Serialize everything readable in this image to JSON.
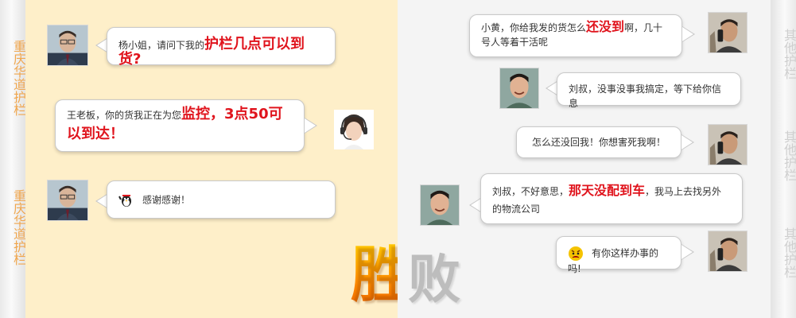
{
  "left_sidebar": {
    "label_1": "重庆华道护栏",
    "label_2": "重庆华道护栏",
    "color": "#f0a64d"
  },
  "right_sidebar": {
    "label_1": "其他护栏",
    "label_2": "其他护栏",
    "label_3": "其他护栏",
    "color": "#cfcfcf"
  },
  "left_panel": {
    "background": "#feefc9",
    "messages": [
      {
        "speaker": "buyer",
        "pre": "杨小姐，请问下我的",
        "highlight": "护栏几点可以到货?",
        "post": ""
      },
      {
        "speaker": "support",
        "pre": "王老板，你的货我正在为您",
        "highlight": "监控，3点50可以到达！",
        "post": ""
      },
      {
        "speaker": "buyer",
        "pre": "",
        "highlight": "",
        "post": "感谢感谢！",
        "icon": "waving-penguin-icon"
      }
    ]
  },
  "right_panel": {
    "background": "#f4f4f4",
    "messages": [
      {
        "speaker": "buyer",
        "pre": "小黄，你给我发的货怎么",
        "highlight": "还没到",
        "post": "啊，几十号人等着干活呢"
      },
      {
        "speaker": "supplier",
        "pre": "",
        "highlight": "",
        "post": "刘叔，没事没事我搞定，等下给你信息"
      },
      {
        "speaker": "buyer",
        "pre": "",
        "highlight": "",
        "post": "怎么还没回我！你想害死我啊！"
      },
      {
        "speaker": "supplier",
        "pre": "刘叔，不好意思，",
        "highlight": "那天没配到车",
        "post": "，我马上去找另外的物流公司"
      },
      {
        "speaker": "buyer",
        "pre": "",
        "highlight": "",
        "post": "有你这样办事的吗!",
        "icon": "angry-face-icon"
      }
    ]
  },
  "verdict": {
    "win": "胜",
    "lose": "败"
  },
  "colors": {
    "highlight": "#e0141d",
    "win_gradient_top": "#ffd200",
    "win_gradient_bottom": "#e85d00",
    "lose": "#bdbdbd"
  }
}
